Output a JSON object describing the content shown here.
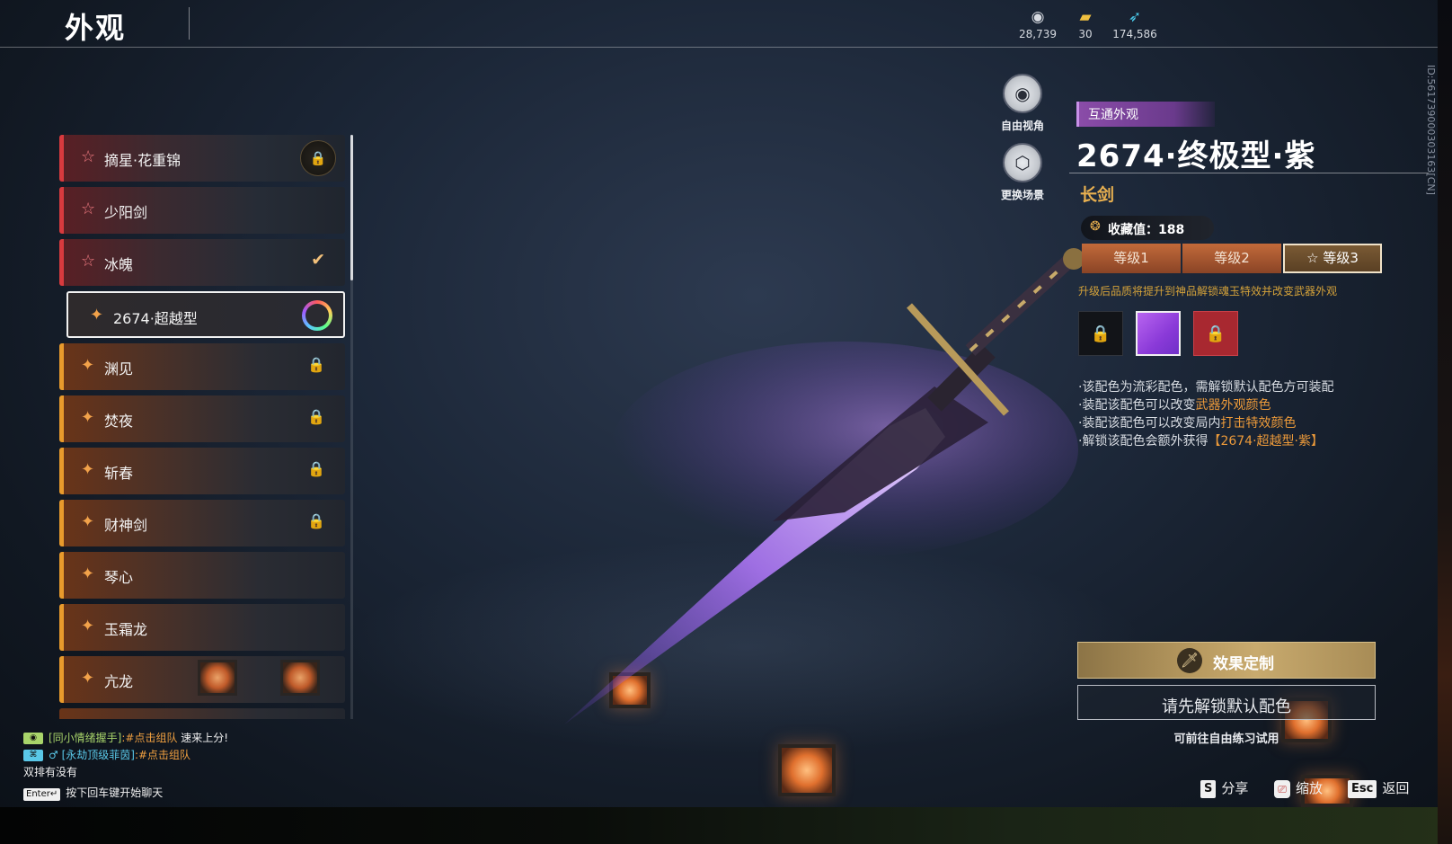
{
  "header": {
    "title": "外观",
    "currencies": [
      {
        "icon": "coin-icon",
        "value": "28,739"
      },
      {
        "icon": "ticket-icon",
        "value": "30"
      },
      {
        "icon": "feather-icon",
        "value": "174,586"
      }
    ]
  },
  "skin_list": [
    {
      "label": "摘星·花重锦",
      "rarity": "red",
      "state": "locked-badge"
    },
    {
      "label": "少阳剑",
      "rarity": "red",
      "state": "none"
    },
    {
      "label": "冰魄",
      "rarity": "red",
      "state": "equipped"
    },
    {
      "label": "2674·超越型",
      "rarity": "orange",
      "state": "selected"
    },
    {
      "label": "渊见",
      "rarity": "orange",
      "state": "locked"
    },
    {
      "label": "焚夜",
      "rarity": "orange",
      "state": "locked"
    },
    {
      "label": "斩春",
      "rarity": "orange",
      "state": "locked"
    },
    {
      "label": "财神剑",
      "rarity": "orange",
      "state": "locked"
    },
    {
      "label": "琴心",
      "rarity": "orange",
      "state": "none"
    },
    {
      "label": "玉霜龙",
      "rarity": "orange",
      "state": "none"
    },
    {
      "label": "亢龙",
      "rarity": "orange",
      "state": "none"
    }
  ],
  "camera": {
    "free_view_label": "自由视角",
    "change_scene_label": "更换场景"
  },
  "detail": {
    "tag": "互通外观",
    "title": "2674·终极型·紫",
    "weapon_type": "长剑",
    "collection_label": "收藏值：188",
    "levels": [
      "等级1",
      "等级2",
      "等级3"
    ],
    "active_level": 2,
    "upgrade_note": "升级后品质将提升到神品解锁魂玉特效并改变武器外观",
    "notes": [
      {
        "pre": "·该配色为流彩配色，需解锁默认配色方可装配",
        "hl": "",
        "post": ""
      },
      {
        "pre": "·装配该配色可以改变",
        "hl": "武器外观颜色",
        "post": ""
      },
      {
        "pre": "·装配该配色可以改变局内",
        "hl": "打击特效颜色",
        "post": ""
      },
      {
        "pre": "·解锁该配色会额外获得",
        "hl": "【2674·超越型·紫】",
        "post": ""
      }
    ],
    "effect_button": "效果定制",
    "unlock_button": "请先解锁默认配色",
    "practice_note": "可前往自由练习试用",
    "vertical_id": "ID:561739000303163[CN]"
  },
  "colors": {
    "accent_gold": "#e8b050",
    "highlight_orange": "#ec9a3a",
    "red_rarity": "#d83a3e",
    "orange_rarity": "#e89a2c",
    "swatch_purple": "#9a48e0",
    "swatch_red": "#a82830"
  },
  "chat": {
    "lines": [
      {
        "badge": "👁",
        "badge_color": "#a8d46a",
        "name": "[同小情绪握手]",
        "name_class": "c-green",
        "link": ":#点击组队",
        "text": " 速来上分!"
      },
      {
        "badge": "♂",
        "badge_color": "#5ac8e8",
        "name": "[永劫顶级菲茵]",
        "name_class": "c-blue",
        "link": ":#点击组队",
        "text": ""
      }
    ],
    "plain_line": "双排有没有",
    "enter_key": "Enter↵",
    "enter_hint": "按下回车键开始聊天"
  },
  "hints": {
    "share_key": "S",
    "share_label": "分享",
    "zoom_label": "缩放",
    "back_key": "Esc",
    "back_label": "返回"
  }
}
